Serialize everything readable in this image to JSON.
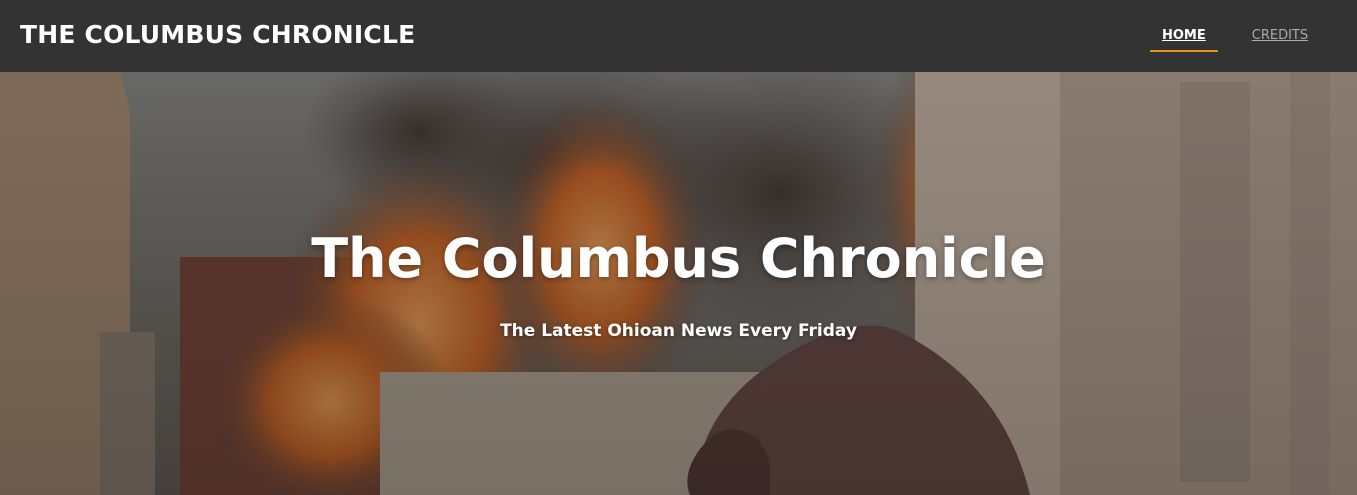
{
  "header": {
    "brand": "THE COLUMBUS CHRONICLE",
    "nav": [
      {
        "label": "HOME",
        "active": true
      },
      {
        "label": "CREDITS",
        "active": false
      }
    ]
  },
  "hero": {
    "title": "The Columbus Chronicle",
    "subtitle": "The Latest Ohioan News Every Friday",
    "image_description_icon": "city-fire-creature-image"
  },
  "colors": {
    "header_bg": "#333333",
    "nav_active_underline": "#e88e1c",
    "text": "#ffffff",
    "nav_inactive": "#aaaaaa"
  }
}
